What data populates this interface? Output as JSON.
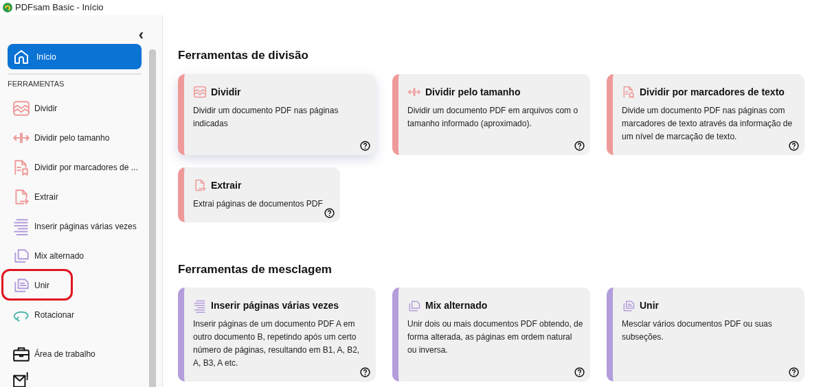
{
  "window": {
    "title": "PDFsam Basic - Início"
  },
  "sidebar": {
    "collapse": "‹",
    "home": {
      "label": "Início",
      "selected": true
    },
    "section": "FERRAMENTAS",
    "items": [
      {
        "label": "Dividir",
        "kind": "split",
        "color": "#ef9a9a",
        "highlighted": false
      },
      {
        "label": "Dividir pelo tamanho",
        "kind": "split-size",
        "color": "#ef9a9a",
        "highlighted": false
      },
      {
        "label": "Dividir por marcadores de ...",
        "kind": "bookmarks",
        "color": "#ef9a9a",
        "highlighted": false
      },
      {
        "label": "Extrair",
        "kind": "extract",
        "color": "#ef9a9a",
        "highlighted": false
      },
      {
        "label": "Inserir páginas várias vezes",
        "kind": "insert",
        "color": "#b39ddb",
        "highlighted": false
      },
      {
        "label": "Mix alternado",
        "kind": "mix",
        "color": "#b39ddb",
        "highlighted": false
      },
      {
        "label": "Unir",
        "kind": "merge",
        "color": "#b39ddb",
        "highlighted": true
      },
      {
        "label": "Rotacionar",
        "kind": "rotate",
        "color": "#4db6ac",
        "highlighted": false
      }
    ],
    "bottom_items": [
      {
        "label": "Área de trabalho",
        "kind": "workspace"
      },
      {
        "kind": "mail"
      }
    ]
  },
  "sections": [
    {
      "title": "Ferramentas de divisão",
      "cards": [
        {
          "title": "Dividir",
          "kind": "split",
          "color": "#ef9a9a",
          "description": "Dividir um documento PDF nas páginas indicadas",
          "hovered": true
        },
        {
          "title": "Dividir pelo tamanho",
          "kind": "split-size",
          "color": "#ef9a9a",
          "description": "Dividir um documento PDF em arquivos com o tamanho informado (aproximado).",
          "hovered": false
        },
        {
          "title": "Dividir por marcadores de texto",
          "kind": "bookmarks",
          "color": "#ef9a9a",
          "description": "Divide um documento PDF nas páginas com marcadores de texto através da informação de um nível de marcação de texto.",
          "hovered": false
        },
        {
          "title": "Extrair",
          "kind": "extract",
          "color": "#ef9a9a",
          "description": "Extrai páginas de documentos PDF",
          "hovered": false
        }
      ]
    },
    {
      "title": "Ferramentas de mesclagem",
      "cards": [
        {
          "title": "Inserir páginas várias vezes",
          "kind": "insert",
          "color": "#b39ddb",
          "description": "Inserir páginas de um documento PDF A em outro documento B, repetindo após um certo número de páginas, resultando em B1, A, B2, A, B3, A etc.",
          "hovered": false
        },
        {
          "title": "Mix alternado",
          "kind": "mix",
          "color": "#b39ddb",
          "description": "Unir dois ou mais documentos PDF obtendo, de forma alterada, as páginas em ordem natural ou inversa.",
          "hovered": false
        },
        {
          "title": "Unir",
          "kind": "merge",
          "color": "#b39ddb",
          "description": "Mesclar vários documentos PDF ou suas subseções.",
          "hovered": false
        }
      ]
    }
  ]
}
